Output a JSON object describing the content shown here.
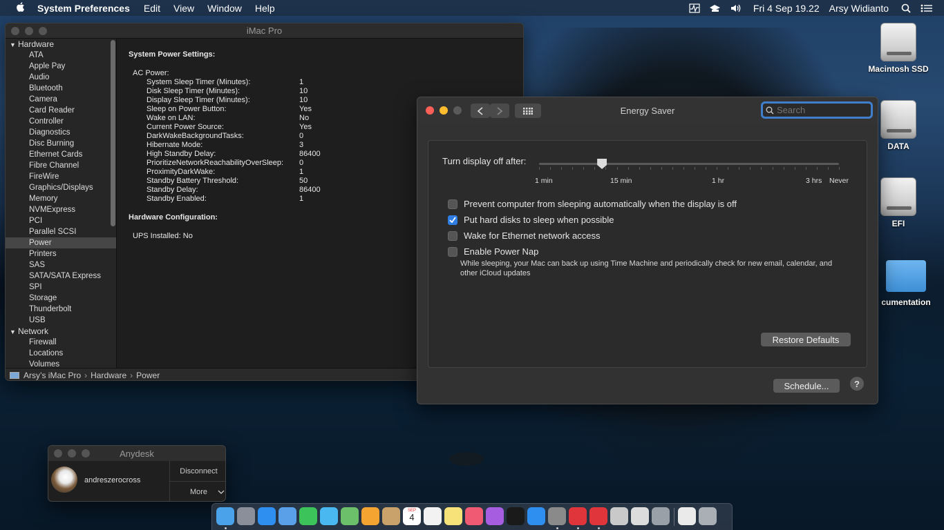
{
  "menubar": {
    "app_name": "System Preferences",
    "menus": [
      "Edit",
      "View",
      "Window",
      "Help"
    ],
    "datetime": "Fri 4 Sep  19.22",
    "user": "Arsy Widianto"
  },
  "sysinfo": {
    "title": "iMac Pro",
    "sidebar": {
      "hardware_group": "Hardware",
      "hardware_items": [
        "ATA",
        "Apple Pay",
        "Audio",
        "Bluetooth",
        "Camera",
        "Card Reader",
        "Controller",
        "Diagnostics",
        "Disc Burning",
        "Ethernet Cards",
        "Fibre Channel",
        "FireWire",
        "Graphics/Displays",
        "Memory",
        "NVMExpress",
        "PCI",
        "Parallel SCSI",
        "Power",
        "Printers",
        "SAS",
        "SATA/SATA Express",
        "SPI",
        "Storage",
        "Thunderbolt",
        "USB"
      ],
      "selected_item": "Power",
      "network_group": "Network",
      "network_items": [
        "Firewall",
        "Locations",
        "Volumes"
      ]
    },
    "content": {
      "heading1": "System Power Settings:",
      "ac_power": "AC Power:",
      "settings": [
        {
          "k": "System Sleep Timer (Minutes):",
          "v": "1"
        },
        {
          "k": "Disk Sleep Timer (Minutes):",
          "v": "10"
        },
        {
          "k": "Display Sleep Timer (Minutes):",
          "v": "10"
        },
        {
          "k": "Sleep on Power Button:",
          "v": "Yes"
        },
        {
          "k": "Wake on LAN:",
          "v": "No"
        },
        {
          "k": "Current Power Source:",
          "v": "Yes"
        },
        {
          "k": "DarkWakeBackgroundTasks:",
          "v": "0"
        },
        {
          "k": "Hibernate Mode:",
          "v": "3"
        },
        {
          "k": "High Standby Delay:",
          "v": "86400"
        },
        {
          "k": "PrioritizeNetworkReachabilityOverSleep:",
          "v": "0"
        },
        {
          "k": "ProximityDarkWake:",
          "v": "1"
        },
        {
          "k": "Standby Battery Threshold:",
          "v": "50"
        },
        {
          "k": "Standby Delay:",
          "v": "86400"
        },
        {
          "k": "Standby Enabled:",
          "v": "1"
        }
      ],
      "heading2": "Hardware Configuration:",
      "ups": "UPS Installed:  No"
    },
    "pathbar": {
      "computer": "Arsy’s iMac Pro",
      "sep1": "›",
      "section": "Hardware",
      "sep2": "›",
      "item": "Power"
    }
  },
  "energy": {
    "title": "Energy Saver",
    "search_placeholder": "Search",
    "display_off_label": "Turn display off after:",
    "slider_value_fraction": 0.21,
    "tick_labels": [
      "1 min",
      "15 min",
      "1 hr",
      "3 hrs",
      "Never"
    ],
    "options": [
      {
        "label": "Prevent computer from sleeping automatically when the display is off",
        "checked": false
      },
      {
        "label": "Put hard disks to sleep when possible",
        "checked": true
      },
      {
        "label": "Wake for Ethernet network access",
        "checked": false
      },
      {
        "label": "Enable Power Nap",
        "checked": false
      }
    ],
    "power_nap_note": "While sleeping, your Mac can back up using Time Machine and periodically check for new email, calendar, and other iCloud updates",
    "restore_defaults": "Restore Defaults",
    "schedule": "Schedule...",
    "help": "?"
  },
  "anydesk": {
    "title": "Anydesk",
    "user": "andreszerocross",
    "disconnect": "Disconnect",
    "more": "More"
  },
  "desktop_icons": [
    "Macintosh SSD",
    "DATA",
    "EFI",
    "cumentation"
  ],
  "dock_icons": [
    "finder-icon",
    "launchpad-icon",
    "safari-icon",
    "mail-icon",
    "facetime-icon",
    "messages-icon",
    "maps-icon",
    "photos-icon",
    "contacts-icon",
    "calendar-icon",
    "reminders-icon",
    "notes-icon",
    "music-icon",
    "podcasts-icon",
    "tv-icon",
    "app-store-icon",
    "system-preferences-icon",
    "anydesk-icon",
    "anydesk-alt-icon",
    "preview-icon",
    "textedit-icon",
    "migration-icon",
    "document-icon",
    "trash-icon"
  ],
  "dock_calendar": {
    "month": "SEP",
    "day": "4"
  }
}
